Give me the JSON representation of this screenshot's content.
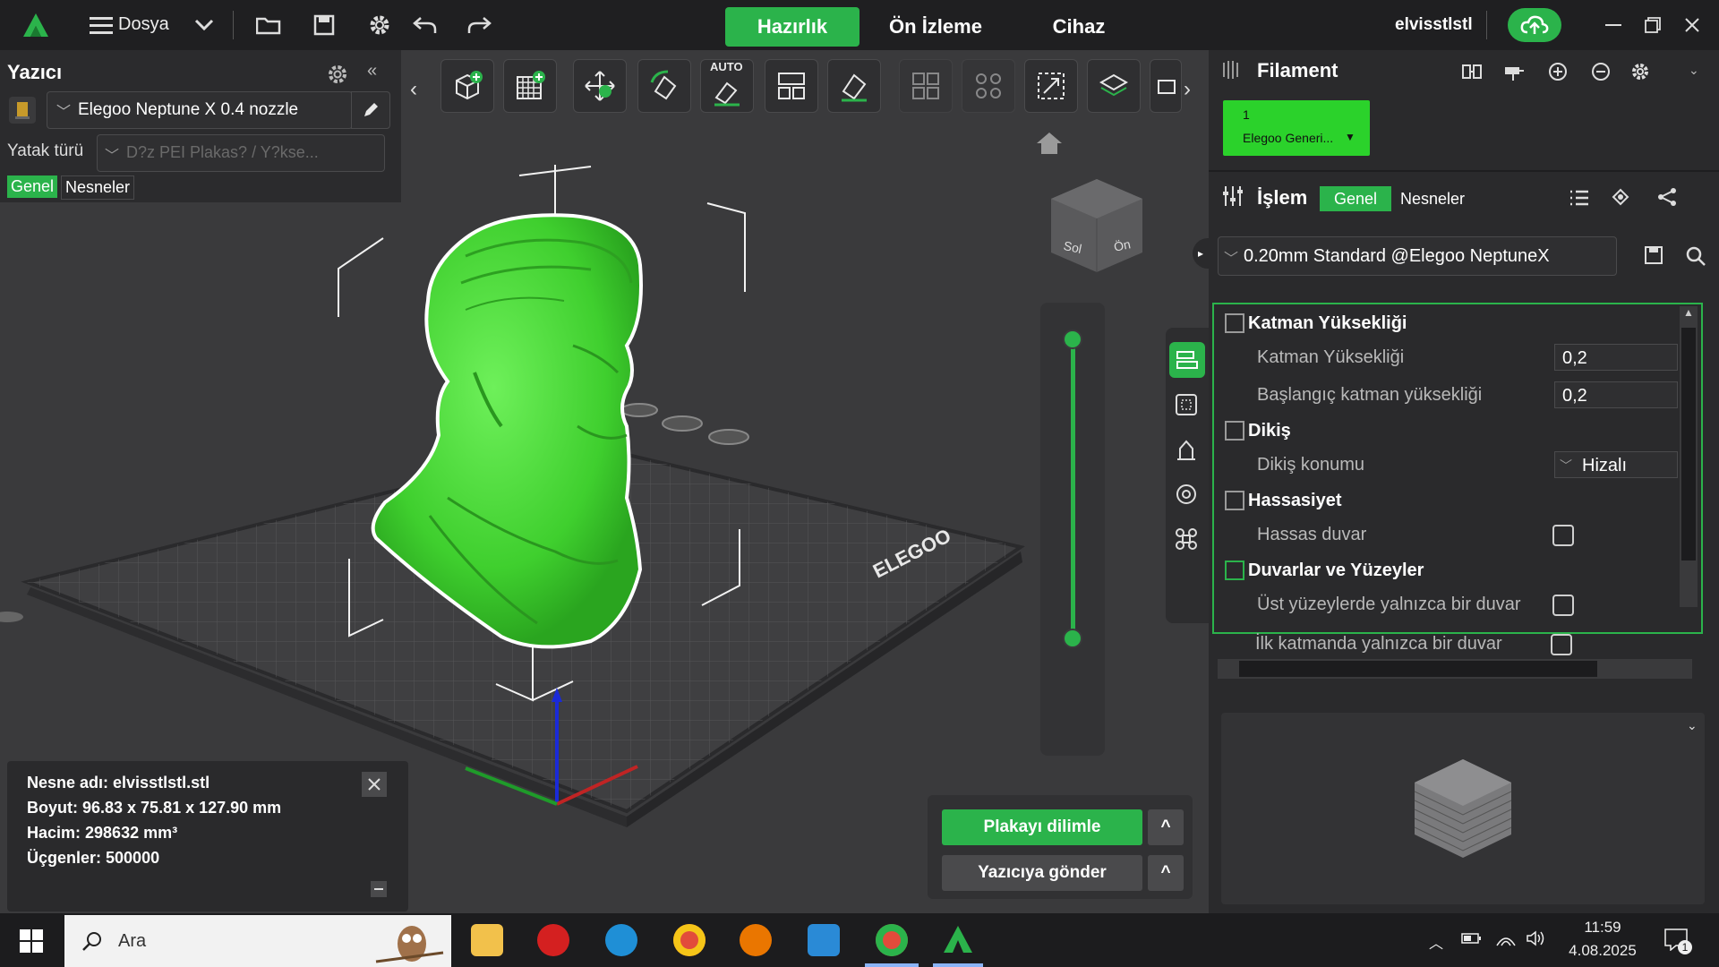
{
  "topbar": {
    "file_label": "Dosya",
    "tabs": [
      "Hazırlık",
      "Ön İzleme",
      "Cihaz"
    ],
    "username": "elvisstlstl",
    "accent": "#2bb34b"
  },
  "printer": {
    "title": "Yazıcı",
    "printer_name": "Elegoo Neptune X 0.4 nozzle",
    "bed_label": "Yatak türü",
    "bed_placeholder": "D?z PEI Plakas? / Y?kse...",
    "tab_general": "Genel",
    "tab_objects": "Nesneler"
  },
  "filament": {
    "title": "Filament",
    "slot_number": "1",
    "slot_name": "Elegoo Generi...",
    "slot_color": "#2bd22b"
  },
  "process": {
    "title": "İşlem",
    "tab_general": "Genel",
    "tab_objects": "Nesneler",
    "preset": "0.20mm Standard @Elegoo NeptuneX"
  },
  "settings": {
    "layer_section": "Katman Yüksekliği",
    "layer_height_label": "Katman Yüksekliği",
    "layer_height_value": "0,2",
    "initial_layer_label": "Başlangıç katman yüksekliği",
    "initial_layer_value": "0,2",
    "seam_section": "Dikiş",
    "seam_position_label": "Dikiş konumu",
    "seam_position_value": "Hizalı",
    "precision_section": "Hassasiyet",
    "precise_wall_label": "Hassas duvar",
    "walls_section": "Duvarlar ve Yüzeyler",
    "top_one_wall_label": "Üst yüzeylerde yalnızca bir duvar",
    "first_layer_one_wall_label": "İlk katmanda yalnızca bir duvar"
  },
  "viewport": {
    "plate_brand": "ELEGOO",
    "cube_left": "Sol",
    "cube_front": "Ön",
    "auto_label": "AUTO"
  },
  "object_info": {
    "name": "Nesne adı: elvisstlstl.stl",
    "size": "Boyut: 96.83 x 75.81 x 127.90 mm",
    "volume": "Hacim: 298632 mm³",
    "triangles": "Üçgenler: 500000"
  },
  "actions": {
    "slice": "Plakayı dilimle",
    "send": "Yazıcıya gönder",
    "caret": "^"
  },
  "taskbar": {
    "search_placeholder": "Ara",
    "time": "11:59",
    "date": "4.08.2025",
    "notifications": "1"
  }
}
